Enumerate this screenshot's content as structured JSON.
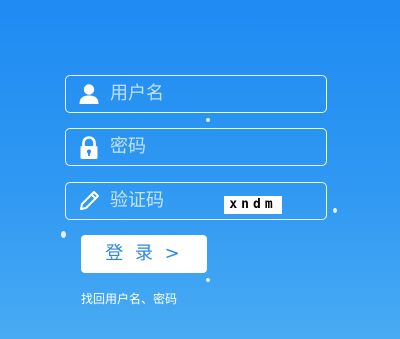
{
  "login_form": {
    "username": {
      "placeholder": "用户名",
      "value": ""
    },
    "password": {
      "placeholder": "密码",
      "value": ""
    },
    "captcha": {
      "placeholder": "验证码",
      "value": "",
      "code": "xndm"
    },
    "submit_label": "登 录 >",
    "forgot_link": "找回用户名、密码"
  },
  "colors": {
    "background_top": "#1f8bf3",
    "background_bottom": "#48abf3",
    "button_text": "#2a87e6"
  },
  "icons": {
    "username": "user-icon",
    "password": "lock-icon",
    "captcha": "pencil-icon"
  }
}
